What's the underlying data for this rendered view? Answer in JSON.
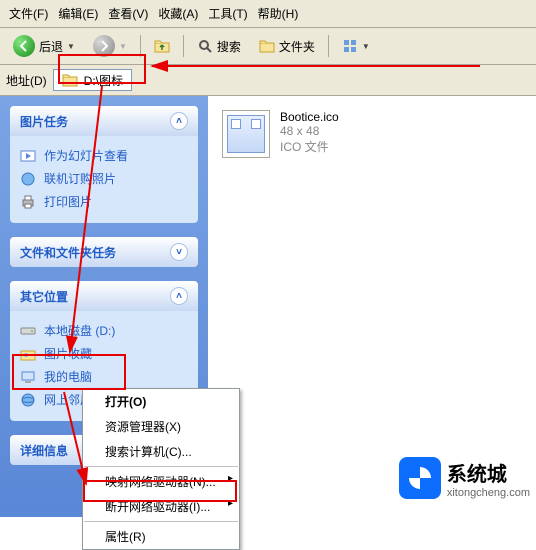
{
  "menu": {
    "file": "文件(F)",
    "edit": "编辑(E)",
    "view": "查看(V)",
    "fav": "收藏(A)",
    "tools": "工具(T)",
    "help": "帮助(H)"
  },
  "toolbar": {
    "back": "后退",
    "search": "搜索",
    "folders": "文件夹"
  },
  "address": {
    "label": "地址(D)",
    "path": "D:\\图标"
  },
  "panels": {
    "pictureTasks": {
      "title": "图片任务",
      "items": [
        {
          "icon": "slideshow",
          "label": "作为幻灯片查看"
        },
        {
          "icon": "order",
          "label": "联机订购照片"
        },
        {
          "icon": "print",
          "label": "打印图片"
        }
      ]
    },
    "fileTasks": {
      "title": "文件和文件夹任务"
    },
    "otherPlaces": {
      "title": "其它位置",
      "items": [
        {
          "icon": "drive",
          "label": "本地磁盘 (D:)"
        },
        {
          "icon": "pictures",
          "label": "图片收藏"
        },
        {
          "icon": "mycomputer",
          "label": "我的电脑"
        },
        {
          "icon": "network",
          "label": "网上邻居"
        }
      ]
    },
    "details": {
      "title": "详细信息"
    }
  },
  "file": {
    "name": "Bootice.ico",
    "dim": "48 x 48",
    "type": "ICO 文件"
  },
  "ctx": {
    "open": "打开(O)",
    "explorer": "资源管理器(X)",
    "searchcomp": "搜索计算机(C)...",
    "mapdrive": "映射网络驱动器(N)...",
    "disconnect": "断开网络驱动器(I)...",
    "properties": "属性(R)"
  },
  "watermark": {
    "cn": "系统城",
    "en": "xitongcheng.com"
  }
}
